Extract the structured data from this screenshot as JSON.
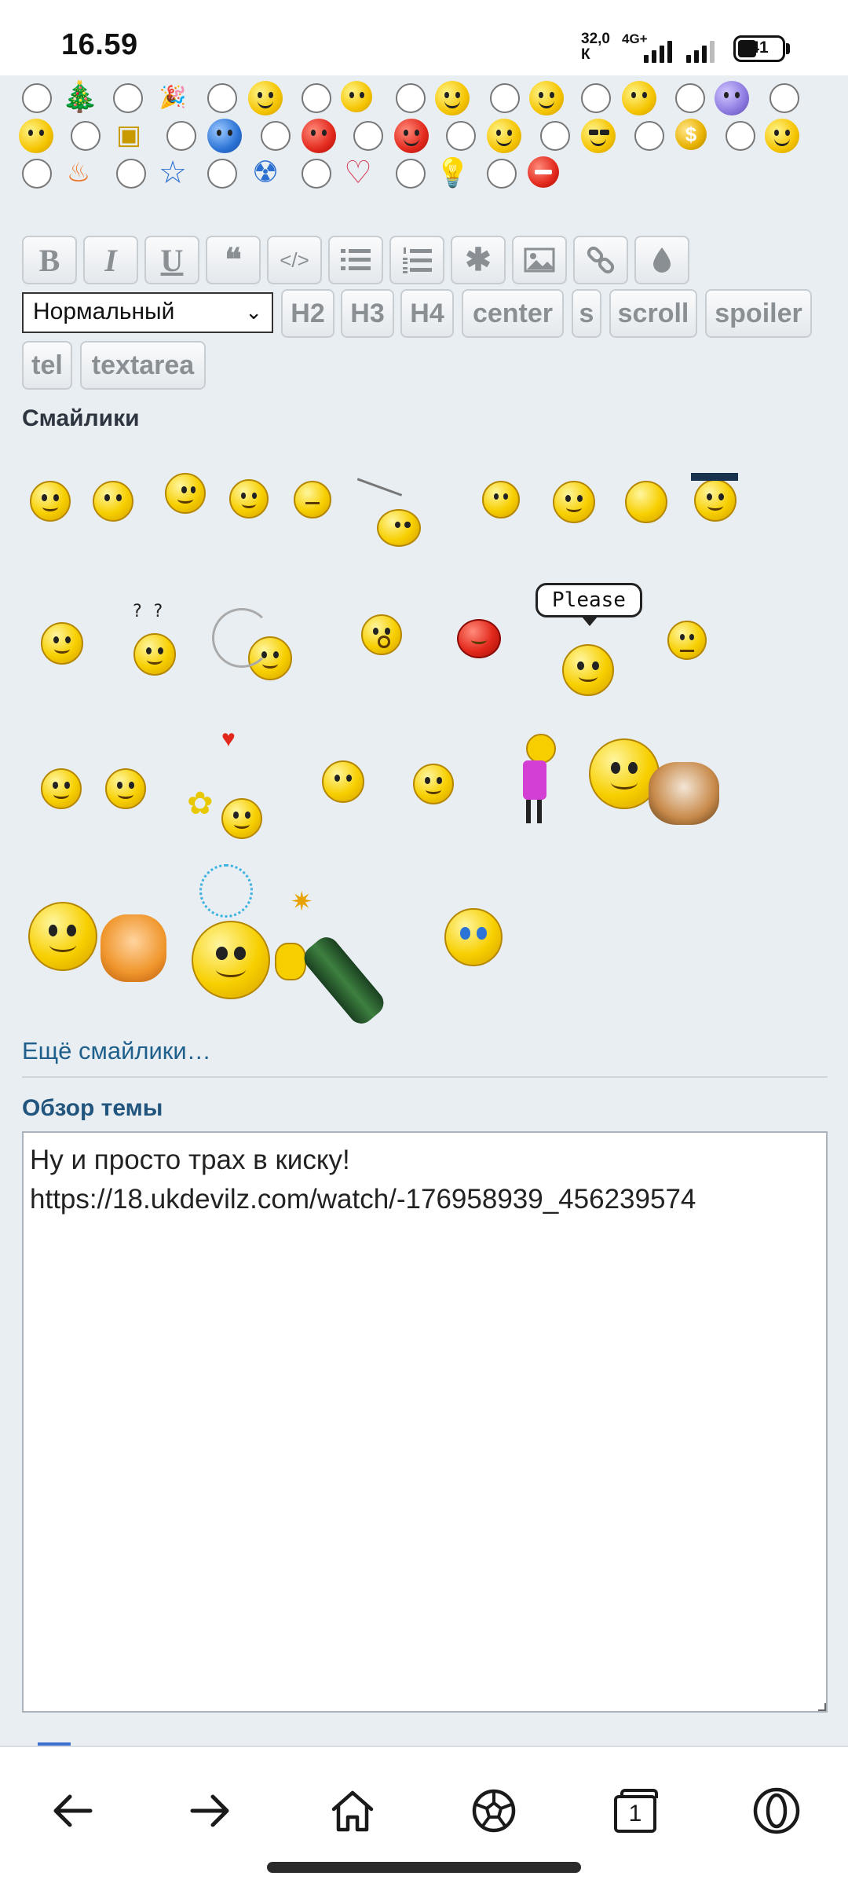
{
  "status_bar": {
    "time": "16.59",
    "net_speed": "32,0\nК",
    "network_type": "4G+",
    "battery": "41"
  },
  "toolbar": {
    "bold": "B",
    "italic": "I",
    "underline": "U",
    "quote": "❝",
    "code": "</>",
    "format_select": "Нормальный",
    "h2": "H2",
    "h3": "H3",
    "h4": "H4",
    "center": "center",
    "strike": "s",
    "scroll": "scroll",
    "spoiler": "spoiler",
    "tel": "tel",
    "textarea": "textarea"
  },
  "emoticons": {
    "section_title": "Смайлики",
    "bubble_text": "Please",
    "question_marks": "? ?",
    "more_link": "Ещё смайлики…"
  },
  "preview": {
    "title": "Обзор темы",
    "text": "Ну и просто трах в киску!\nhttps://18.ukdevilz.com/watch/-176958939_456239574"
  },
  "nav": {
    "tabs_count": "1"
  },
  "colors": {
    "page_bg": "#e9eef2",
    "link": "#1f5f8b",
    "preview_title": "#22557d"
  }
}
